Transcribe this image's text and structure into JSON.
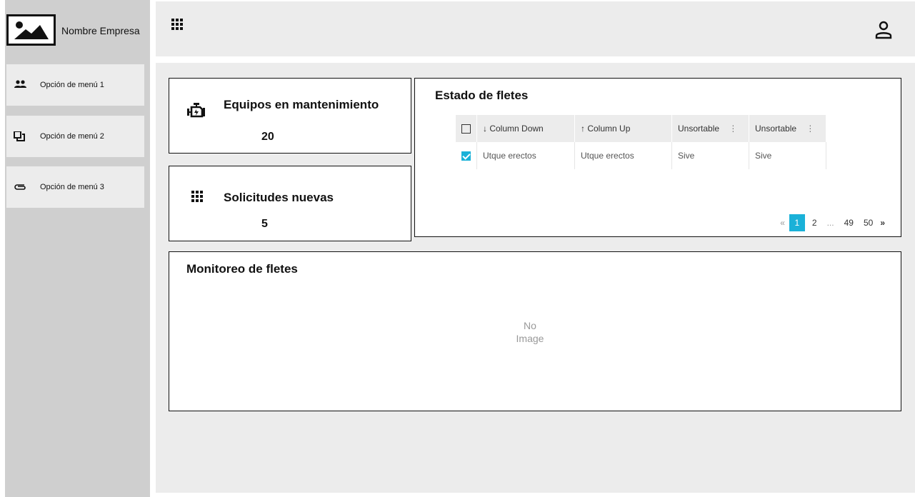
{
  "brand": {
    "name": "Nombre Empresa",
    "logo_icon": "image-icon"
  },
  "sidebar": {
    "items": [
      {
        "label": "Opción de menú 1",
        "icon": "people-icon"
      },
      {
        "label": "Opción de menú 2",
        "icon": "copy-icon"
      },
      {
        "label": "Opción de menú 3",
        "icon": "attachment-icon"
      }
    ]
  },
  "topbar": {
    "apps_icon": "apps-grid-icon",
    "user_icon": "user-icon"
  },
  "stats": {
    "maintenance": {
      "title": "Equipos en mantenimiento",
      "value": "20",
      "icon": "engine-icon"
    },
    "requests": {
      "title": "Solicitudes nuevas",
      "value": "5",
      "icon": "apps-grid-icon"
    }
  },
  "freight_status": {
    "title": "Estado de fletes",
    "columns": [
      "Column Down",
      "Column Up",
      "Unsortable",
      "Unsortable"
    ],
    "column_arrows": [
      "↓",
      "↑",
      "",
      ""
    ],
    "rows": [
      {
        "checked": true,
        "cells": [
          "Utque erectos",
          "Utque erectos",
          "Sive",
          "Sive"
        ]
      }
    ],
    "pagination": {
      "prev": "«",
      "pages": [
        "1",
        "2",
        "...",
        "49",
        "50"
      ],
      "active": "1",
      "next": "»"
    }
  },
  "monitoring": {
    "title": "Monitoreo de fletes",
    "placeholder_line1": "No",
    "placeholder_line2": "Image"
  },
  "colors": {
    "accent": "#1ab1d8",
    "sidebar_bg": "#cfcfcf",
    "panel_bg": "#ececec"
  }
}
